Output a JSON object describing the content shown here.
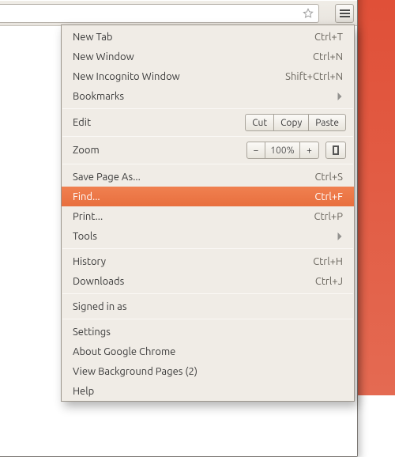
{
  "toolbar": {
    "bookmark_star": "star-icon",
    "menu_button": "hamburger-icon"
  },
  "menu": {
    "new_tab": {
      "label": "New Tab",
      "shortcut": "Ctrl+T"
    },
    "new_window": {
      "label": "New Window",
      "shortcut": "Ctrl+N"
    },
    "incognito": {
      "label": "New Incognito Window",
      "shortcut": "Shift+Ctrl+N"
    },
    "bookmarks": {
      "label": "Bookmarks"
    },
    "edit": {
      "label": "Edit",
      "cut": "Cut",
      "copy": "Copy",
      "paste": "Paste"
    },
    "zoom": {
      "label": "Zoom",
      "minus": "−",
      "level": "100%",
      "plus": "+"
    },
    "save_as": {
      "label": "Save Page As...",
      "shortcut": "Ctrl+S"
    },
    "find": {
      "label": "Find...",
      "shortcut": "Ctrl+F"
    },
    "print": {
      "label": "Print...",
      "shortcut": "Ctrl+P"
    },
    "tools": {
      "label": "Tools"
    },
    "history": {
      "label": "History",
      "shortcut": "Ctrl+H"
    },
    "downloads": {
      "label": "Downloads",
      "shortcut": "Ctrl+J"
    },
    "signed_in": {
      "label": "Signed in as"
    },
    "settings": {
      "label": "Settings"
    },
    "about": {
      "label": "About Google Chrome"
    },
    "bg_pages": {
      "label": "View Background Pages (2)"
    },
    "help": {
      "label": "Help"
    }
  }
}
